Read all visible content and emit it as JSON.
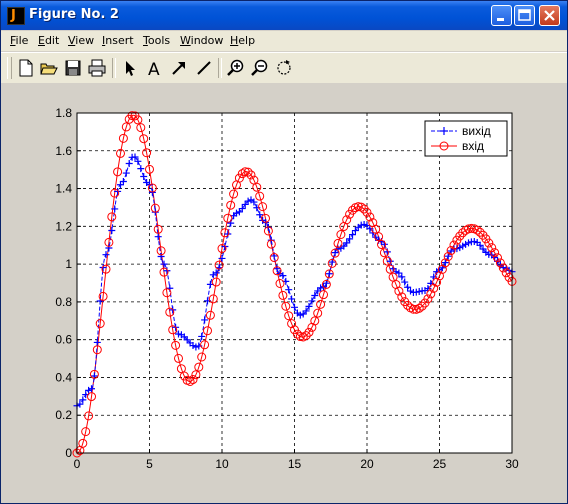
{
  "window": {
    "title": "Figure No. 2",
    "app_icon": "matlab-icon",
    "controls": [
      "minimize-icon",
      "maximize-icon",
      "close-icon"
    ]
  },
  "menu": [
    {
      "label": "File",
      "key": "F",
      "rest": "ile"
    },
    {
      "label": "Edit",
      "key": "E",
      "rest": "dit"
    },
    {
      "label": "View",
      "key": "V",
      "rest": "iew"
    },
    {
      "label": "Insert",
      "key": "I",
      "rest": "nsert"
    },
    {
      "label": "Tools",
      "key": "T",
      "rest": "ools"
    },
    {
      "label": "Window",
      "key": "W",
      "rest": "indow"
    },
    {
      "label": "Help",
      "key": "H",
      "rest": "elp"
    }
  ],
  "toolbar": {
    "icons": [
      "new-file-icon",
      "open-folder-icon",
      "save-icon",
      "print-icon",
      "select-arrow-icon",
      "insert-text-icon",
      "insert-arrow-icon",
      "insert-line-icon",
      "zoom-in-icon",
      "zoom-out-icon",
      "rotate-icon"
    ]
  },
  "chart_data": {
    "type": "line",
    "title": "",
    "xlabel": "",
    "ylabel": "",
    "xlim": [
      0,
      30
    ],
    "ylim": [
      0,
      1.8
    ],
    "xticks": [
      "0",
      "5",
      "10",
      "15",
      "20",
      "25",
      "30"
    ],
    "yticks": [
      "0",
      "0.2",
      "0.4",
      "0.6",
      "0.8",
      "1",
      "1.2",
      "1.4",
      "1.6",
      "1.8"
    ],
    "grid": true,
    "legend_position": "top-right",
    "series": [
      {
        "name": "вихід",
        "color": "#0000ff",
        "marker": "+",
        "linestyle": "dashed",
        "x": [
          0,
          1,
          2,
          3,
          3.9,
          5,
          6,
          7,
          8.3,
          9.5,
          11,
          12,
          13,
          14,
          15.4,
          17,
          18,
          19.8,
          21,
          22,
          23.2,
          24,
          25,
          26,
          27.4,
          28.5,
          29.5,
          30
        ],
        "y": [
          0.25,
          0.34,
          1.05,
          1.42,
          1.57,
          1.42,
          1.0,
          0.63,
          0.56,
          0.95,
          1.27,
          1.34,
          1.22,
          0.95,
          0.73,
          0.88,
          1.08,
          1.21,
          1.12,
          0.96,
          0.85,
          0.86,
          0.97,
          1.08,
          1.12,
          1.05,
          0.98,
          0.96
        ]
      },
      {
        "name": "вхід",
        "color": "#ff0000",
        "marker": "o",
        "linestyle": "solid",
        "x": [
          0,
          0.8,
          1.8,
          2.8,
          3.8,
          4.8,
          5.8,
          6.8,
          7.8,
          8.8,
          9.8,
          10.8,
          11.6,
          12.6,
          13.6,
          14.6,
          15.4,
          16.4,
          17.4,
          18.4,
          19.5,
          20.4,
          21.4,
          22.4,
          23.3,
          24.3,
          25.3,
          26.3,
          27.2,
          28.2,
          29.2,
          30
        ]
      }
    ]
  }
}
